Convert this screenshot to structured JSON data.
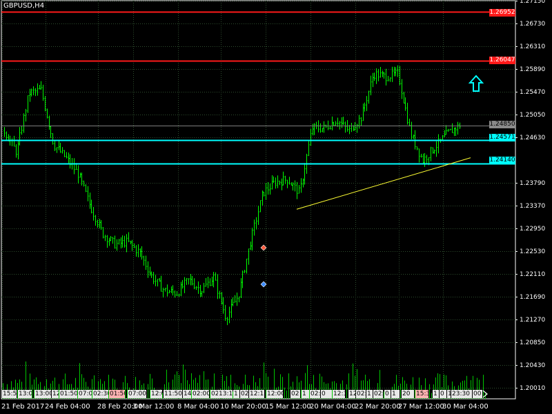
{
  "chart": {
    "symbol": "GBPUSD,H4",
    "colors": {
      "background": "#000000",
      "grid": "#2f4f2f",
      "candle": "#00ff00",
      "volume": "#00c800",
      "resistance": "#ff1a1a",
      "support": "#00ffff",
      "trendline": "#ffff33",
      "last_price": "#7f7f7f",
      "arrow": "#00ffff"
    },
    "price_axis": [
      "1.27150",
      "1.26730",
      "1.26310",
      "1.25890",
      "1.25470",
      "1.25050",
      "1.24630",
      "1.23790",
      "1.23370",
      "1.22950",
      "1.22530",
      "1.22110",
      "1.21690",
      "1.21270",
      "1.20850",
      "1.20430",
      "1.20010"
    ],
    "time_axis": [
      "21 Feb 2017",
      "24 Feb 04:00",
      "28 Feb 20:00",
      "3 Mar 12:00",
      "8 Mar 04:00",
      "10 Mar 20:00",
      "15 Mar 12:00",
      "20 Mar 04:00",
      "22 Mar 20:00",
      "27 Mar 12:00",
      "30 Mar 04:00"
    ],
    "price_tags": {
      "resistance_top": "1.26952",
      "resistance_2": "1.26047",
      "last_price": "1.24850",
      "support_1": "1.24571",
      "support_2": "1.24140"
    },
    "balloons": [
      "15:50",
      "13:0",
      "13:00",
      "12",
      "01:50",
      "07:0",
      "02:30",
      "01:50",
      "07:00",
      "12:0",
      "11:50",
      "14",
      "02:00",
      "02",
      "13:1",
      "1",
      "02",
      "12:1",
      "12:00",
      "02",
      "1",
      "02:0",
      "0",
      "12:3",
      "12",
      "02:",
      "1",
      "02:",
      "0",
      "1",
      "20",
      "15:3",
      "1",
      "0",
      "1",
      "23:30",
      "00"
    ],
    "icons": {
      "buy_arrow": "up-arrow-icon",
      "sell_marker": "diamond-marker-icon",
      "buy_marker": "diamond-marker-icon",
      "scroll_end": "chevron-right-icon"
    },
    "chart_data": {
      "type": "candlestick",
      "title": "GBPUSD,H4",
      "timeframe": "H4",
      "ylim": [
        1.198,
        1.2715
      ],
      "x_range": [
        "21 Feb 2017",
        "31 Mar 2017"
      ],
      "close_points": [
        {
          "x": "21 Feb 2017",
          "y": 1.2475
        },
        {
          "x": "22 Feb 2017",
          "y": 1.2435
        },
        {
          "x": "23 Feb 2017",
          "y": 1.2545
        },
        {
          "x": "24 Feb 04:00",
          "y": 1.255
        },
        {
          "x": "24 Feb 12:00",
          "y": 1.245
        },
        {
          "x": "27 Feb 2017",
          "y": 1.2425
        },
        {
          "x": "28 Feb 2017",
          "y": 1.2395
        },
        {
          "x": "28 Feb 20:00",
          "y": 1.2335
        },
        {
          "x": "1 Mar 2017",
          "y": 1.2285
        },
        {
          "x": "2 Mar 2017",
          "y": 1.2265
        },
        {
          "x": "3 Mar 12:00",
          "y": 1.227
        },
        {
          "x": "6 Mar 2017",
          "y": 1.225
        },
        {
          "x": "7 Mar 2017",
          "y": 1.2205
        },
        {
          "x": "8 Mar 04:00",
          "y": 1.218
        },
        {
          "x": "9 Mar 2017",
          "y": 1.2175
        },
        {
          "x": "10 Mar 2017",
          "y": 1.22
        },
        {
          "x": "10 Mar 20:00",
          "y": 1.218
        },
        {
          "x": "13 Mar 2017",
          "y": 1.2205
        },
        {
          "x": "14 Mar 2017",
          "y": 1.213
        },
        {
          "x": "15 Mar 2017",
          "y": 1.217
        },
        {
          "x": "15 Mar 12:00",
          "y": 1.227
        },
        {
          "x": "16 Mar 2017",
          "y": 1.236
        },
        {
          "x": "17 Mar 2017",
          "y": 1.238
        },
        {
          "x": "20 Mar 04:00",
          "y": 1.2385
        },
        {
          "x": "20 Mar 12:00",
          "y": 1.236
        },
        {
          "x": "21 Mar 2017",
          "y": 1.248
        },
        {
          "x": "22 Mar 2017",
          "y": 1.248
        },
        {
          "x": "22 Mar 20:00",
          "y": 1.2495
        },
        {
          "x": "23 Mar 2017",
          "y": 1.2475
        },
        {
          "x": "24 Mar 2017",
          "y": 1.25
        },
        {
          "x": "27 Mar 2017",
          "y": 1.258
        },
        {
          "x": "27 Mar 12:00",
          "y": 1.2575
        },
        {
          "x": "28 Mar 2017",
          "y": 1.258
        },
        {
          "x": "28 Mar 12:00",
          "y": 1.247
        },
        {
          "x": "29 Mar 2017",
          "y": 1.242
        },
        {
          "x": "30 Mar 04:00",
          "y": 1.2445
        },
        {
          "x": "30 Mar 20:00",
          "y": 1.247
        },
        {
          "x": "31 Mar 2017",
          "y": 1.2485
        }
      ],
      "horizontal_levels": [
        1.26952,
        1.26047,
        1.2485,
        1.24571,
        1.2414
      ],
      "trendline": [
        {
          "x": "17 Mar 2017",
          "y": 1.233
        },
        {
          "x": "31 Mar 2017",
          "y": 1.2425
        }
      ],
      "volume": "histogram"
    }
  }
}
